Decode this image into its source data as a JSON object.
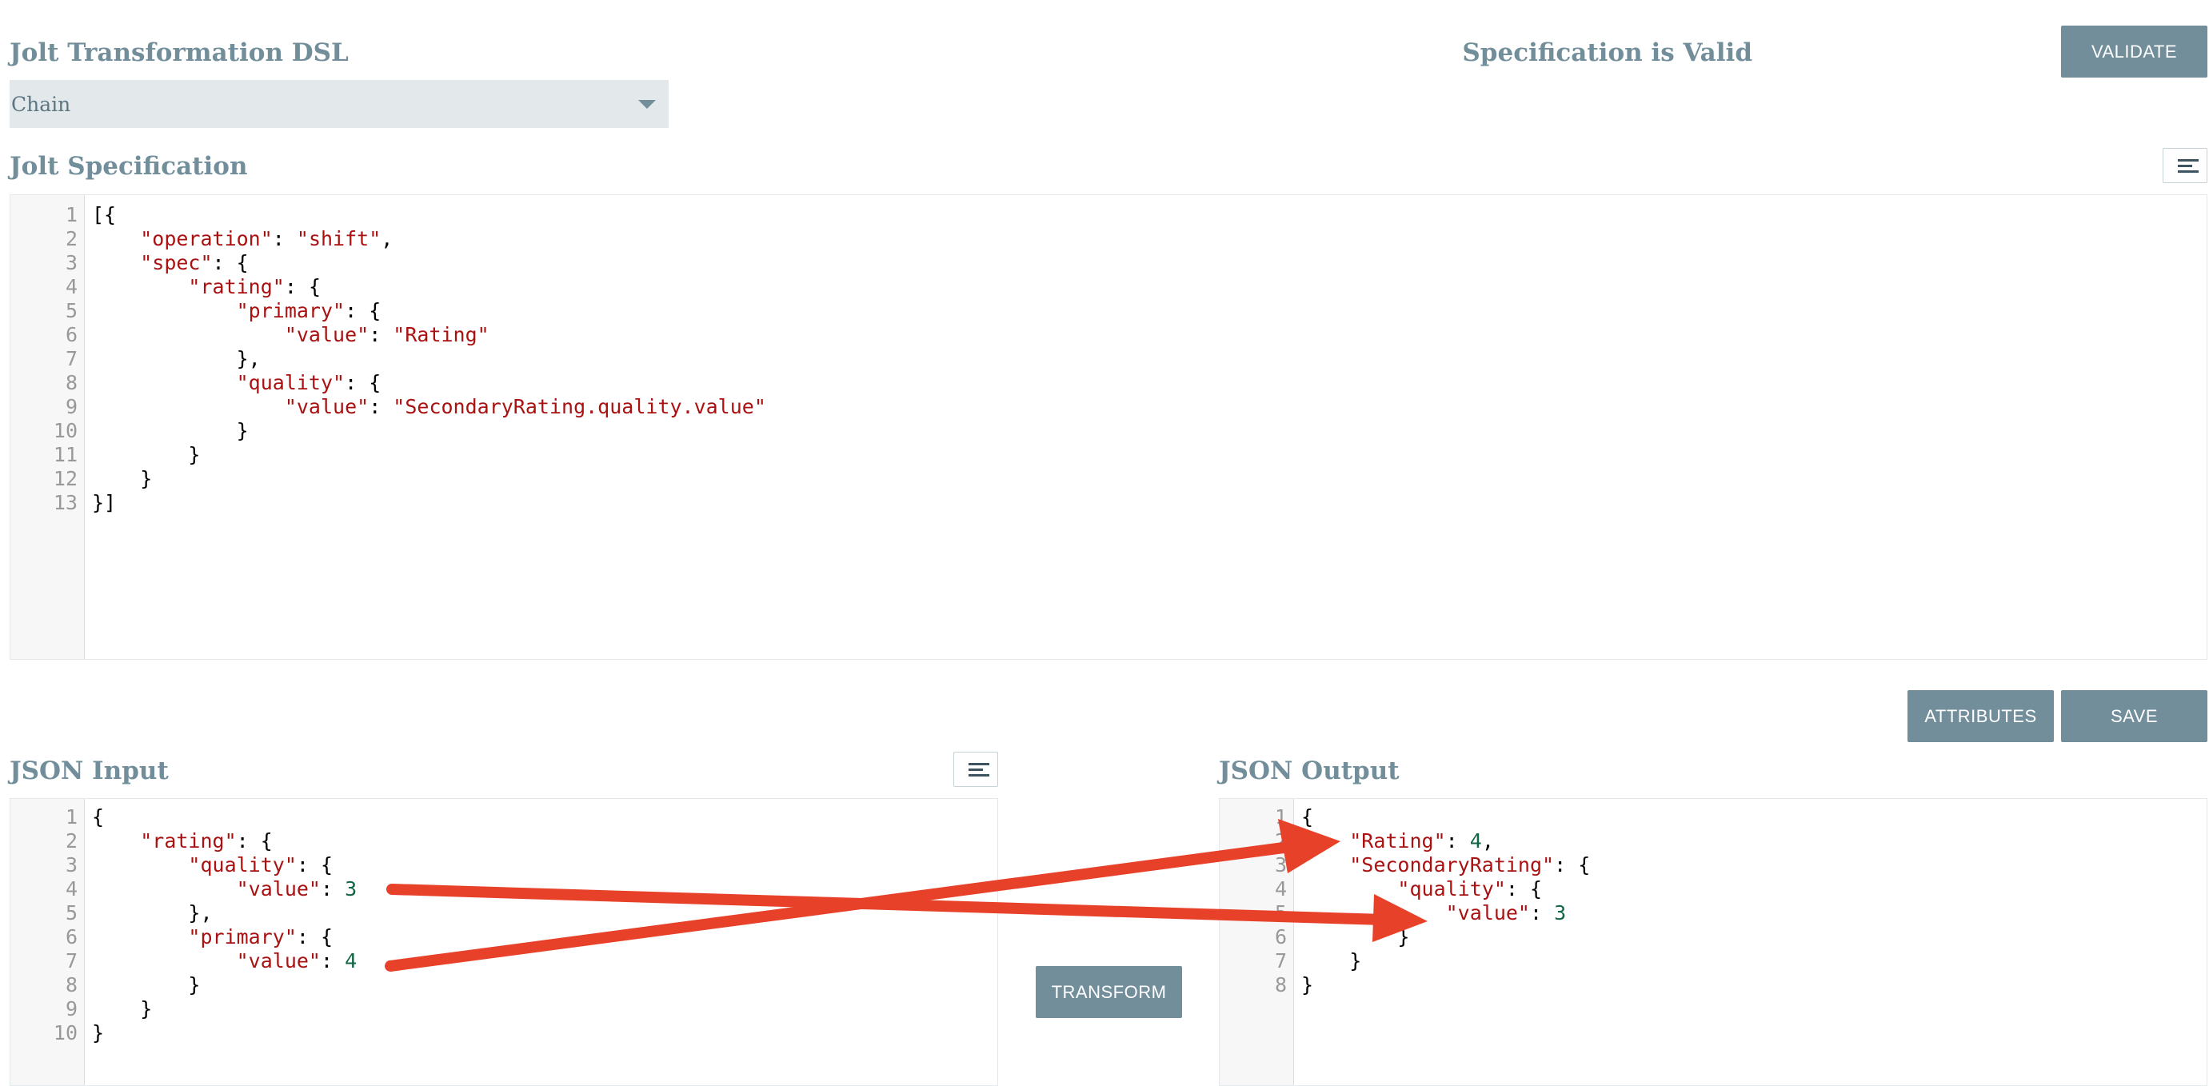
{
  "dsl": {
    "heading": "Jolt Transformation DSL",
    "selected": "Chain"
  },
  "validation": {
    "status": "Specification is Valid",
    "validate_label": "VALIDATE"
  },
  "spec": {
    "heading": "Jolt Specification",
    "format_icon": "align-left-icon",
    "lines": [
      [
        [
          "p",
          "[{"
        ]
      ],
      [
        [
          "p",
          "    "
        ],
        [
          "s",
          "\"operation\""
        ],
        [
          "p",
          ": "
        ],
        [
          "s",
          "\"shift\""
        ],
        [
          "p",
          ","
        ]
      ],
      [
        [
          "p",
          "    "
        ],
        [
          "s",
          "\"spec\""
        ],
        [
          "p",
          ": {"
        ]
      ],
      [
        [
          "p",
          "        "
        ],
        [
          "s",
          "\"rating\""
        ],
        [
          "p",
          ": {"
        ]
      ],
      [
        [
          "p",
          "            "
        ],
        [
          "s",
          "\"primary\""
        ],
        [
          "p",
          ": {"
        ]
      ],
      [
        [
          "p",
          "                "
        ],
        [
          "s",
          "\"value\""
        ],
        [
          "p",
          ": "
        ],
        [
          "s",
          "\"Rating\""
        ]
      ],
      [
        [
          "p",
          "            },"
        ]
      ],
      [
        [
          "p",
          "            "
        ],
        [
          "s",
          "\"quality\""
        ],
        [
          "p",
          ": {"
        ]
      ],
      [
        [
          "p",
          "                "
        ],
        [
          "s",
          "\"value\""
        ],
        [
          "p",
          ": "
        ],
        [
          "s",
          "\"SecondaryRating.quality.value\""
        ]
      ],
      [
        [
          "p",
          "            }"
        ]
      ],
      [
        [
          "p",
          "        }"
        ]
      ],
      [
        [
          "p",
          "    }"
        ]
      ],
      [
        [
          "p",
          "}]"
        ]
      ]
    ]
  },
  "actions": {
    "attributes_label": "ATTRIBUTES",
    "save_label": "SAVE"
  },
  "input": {
    "heading": "JSON Input",
    "format_icon": "align-left-icon",
    "lines": [
      [
        [
          "p",
          "{"
        ]
      ],
      [
        [
          "p",
          "    "
        ],
        [
          "s",
          "\"rating\""
        ],
        [
          "p",
          ": {"
        ]
      ],
      [
        [
          "p",
          "        "
        ],
        [
          "s",
          "\"quality\""
        ],
        [
          "p",
          ": {"
        ]
      ],
      [
        [
          "p",
          "            "
        ],
        [
          "s",
          "\"value\""
        ],
        [
          "p",
          ": "
        ],
        [
          "n",
          "3"
        ]
      ],
      [
        [
          "p",
          "        },"
        ]
      ],
      [
        [
          "p",
          "        "
        ],
        [
          "s",
          "\"primary\""
        ],
        [
          "p",
          ": {"
        ]
      ],
      [
        [
          "p",
          "            "
        ],
        [
          "s",
          "\"value\""
        ],
        [
          "p",
          ": "
        ],
        [
          "n",
          "4"
        ]
      ],
      [
        [
          "p",
          "        }"
        ]
      ],
      [
        [
          "p",
          "    }"
        ]
      ],
      [
        [
          "p",
          "}"
        ]
      ]
    ]
  },
  "transform": {
    "label": "TRANSFORM"
  },
  "output": {
    "heading": "JSON Output",
    "lines": [
      [
        [
          "p",
          "{"
        ]
      ],
      [
        [
          "p",
          "    "
        ],
        [
          "s",
          "\"Rating\""
        ],
        [
          "p",
          ": "
        ],
        [
          "n",
          "4"
        ],
        [
          "p",
          ","
        ]
      ],
      [
        [
          "p",
          "    "
        ],
        [
          "s",
          "\"SecondaryRating\""
        ],
        [
          "p",
          ": {"
        ]
      ],
      [
        [
          "p",
          "        "
        ],
        [
          "s",
          "\"quality\""
        ],
        [
          "p",
          ": {"
        ]
      ],
      [
        [
          "p",
          "            "
        ],
        [
          "s",
          "\"value\""
        ],
        [
          "p",
          ": "
        ],
        [
          "n",
          "3"
        ]
      ],
      [
        [
          "p",
          "        }"
        ]
      ],
      [
        [
          "p",
          "    }"
        ]
      ],
      [
        [
          "p",
          "}"
        ]
      ]
    ]
  },
  "annotation": {
    "color": "#e8412a",
    "arrows": [
      "arrow-icon",
      "arrow-icon"
    ]
  }
}
